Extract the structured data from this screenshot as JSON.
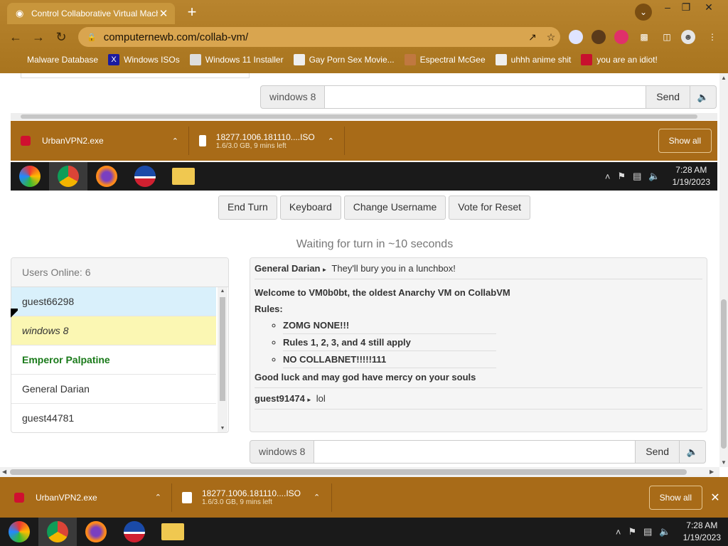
{
  "browser": {
    "tab_title": "Control Collaborative Virtual Mach",
    "url": "computernewb.com/collab-vm/",
    "bookmarks": [
      "Malware Database",
      "Windows ISOs",
      "Windows 11 Installer",
      "Gay Porn Sex Movie...",
      "Espectral McGee",
      "uhhh anime shit",
      "you are an idiot!"
    ]
  },
  "vm_screen": {
    "chat_name": "windows 8",
    "send_label": "Send",
    "downloads": [
      {
        "name": "UrbanVPN2.exe"
      },
      {
        "name": "18277.1006.181110....ISO",
        "meta": "1.6/3.0 GB, 9 mins left"
      }
    ],
    "show_all": "Show all",
    "clock_time": "7:28 AM",
    "clock_date": "1/19/2023"
  },
  "controls": {
    "end_turn": "End Turn",
    "keyboard": "Keyboard",
    "change_username": "Change Username",
    "vote_reset": "Vote for Reset"
  },
  "status": {
    "waiting": "Waiting for turn in ~10 seconds"
  },
  "users": {
    "header": "Users Online: 6",
    "list": [
      "guest66298",
      "windows 8",
      "Emperor Palpatine",
      "General Darian",
      "guest44781"
    ]
  },
  "chat": {
    "msg1_user": "General Darian",
    "msg1_text": "They'll bury you in a lunchbox!",
    "welcome": "Welcome to VM0b0bt, the oldest Anarchy VM on CollabVM",
    "rules_label": "Rules:",
    "rules": [
      "ZOMG NONE!!!",
      "Rules 1, 2, 3, and 4 still apply",
      "NO COLLABNET!!!!!111"
    ],
    "goodbye": "Good luck and may god have mercy on your souls",
    "msg2_user": "guest91474",
    "msg2_text": "lol"
  },
  "chat_input": {
    "name": "windows 8",
    "send": "Send"
  },
  "shelf": {
    "downloads": [
      {
        "name": "UrbanVPN2.exe"
      },
      {
        "name": "18277.1006.181110....ISO",
        "meta": "1.6/3.0 GB, 9 mins left"
      }
    ],
    "show_all": "Show all"
  },
  "taskbar": {
    "time": "7:28 AM",
    "date": "1/19/2023"
  },
  "colors": {
    "chrome": "#a86b18",
    "user_highlight": "#d9f0fb",
    "user_self": "#fbf7b3",
    "admin_green": "#1a7a1a"
  }
}
